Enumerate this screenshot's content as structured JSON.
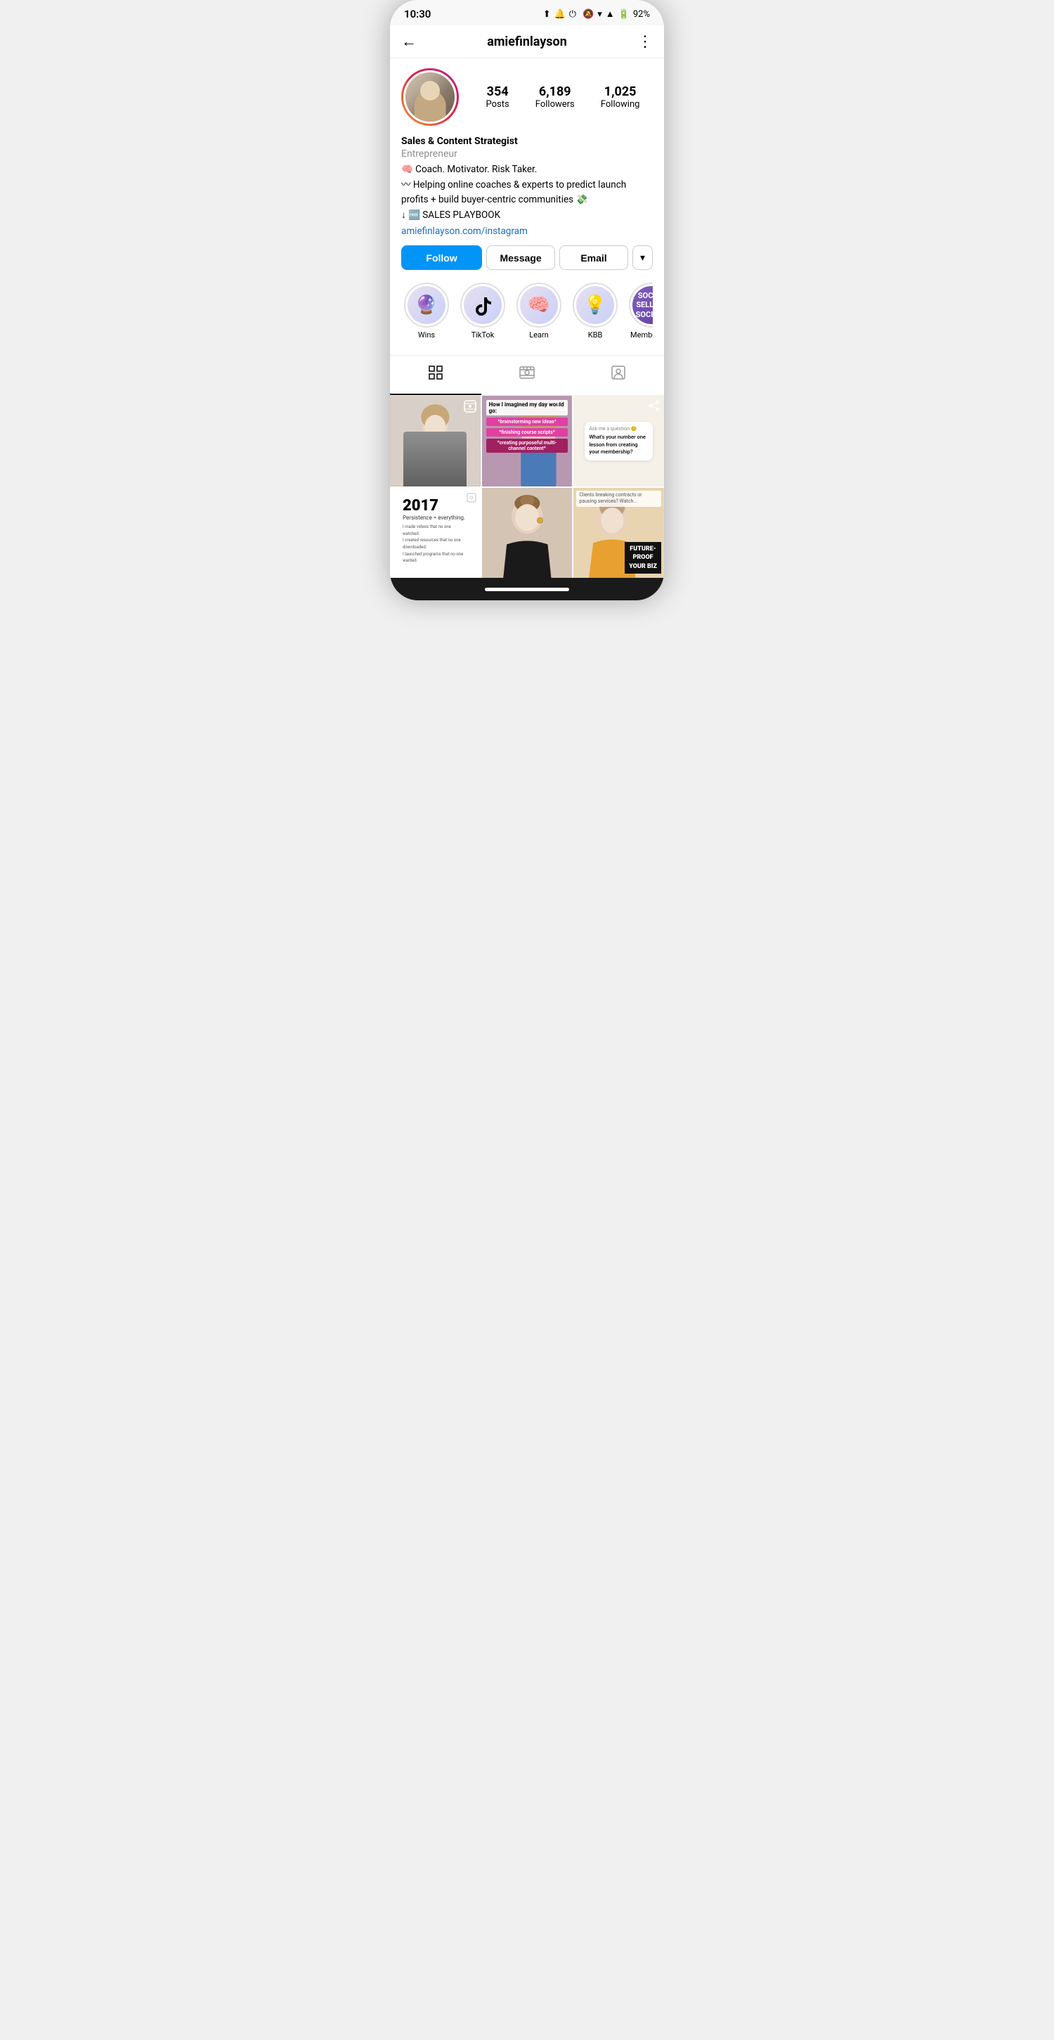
{
  "statusBar": {
    "time": "10:30",
    "battery": "92%"
  },
  "header": {
    "username": "amiefinlayson",
    "back_label": "←",
    "more_label": "⋮"
  },
  "profile": {
    "stats": {
      "posts_count": "354",
      "posts_label": "Posts",
      "followers_count": "6,189",
      "followers_label": "Followers",
      "following_count": "1,025",
      "following_label": "Following"
    },
    "bio": {
      "name": "Sales & Content Strategist",
      "category": "Entrepreneur",
      "line1": "🧠 Coach. Motivator. Risk Taker.",
      "line2": "〰 Helping online coaches & experts to predict launch profits + build buyer-centric communities 💸",
      "line3": "↓ 🆓 SALES PLAYBOOK",
      "link": "amiefinlayson.com/instagram"
    }
  },
  "buttons": {
    "follow": "Follow",
    "message": "Message",
    "email": "Email",
    "dropdown": "▾"
  },
  "highlights": [
    {
      "id": "wins",
      "icon": "🔮",
      "label": "Wins"
    },
    {
      "id": "tiktok",
      "icon": "♪",
      "label": "TikTok"
    },
    {
      "id": "learn",
      "icon": "🧠",
      "label": "Learn"
    },
    {
      "id": "kbb",
      "icon": "💡",
      "label": "KBB"
    },
    {
      "id": "membership",
      "text": "SOCIAL\nSELLING\nSOCIETY",
      "label": "Membersh…"
    }
  ],
  "tabs": [
    {
      "id": "grid",
      "icon": "⊞",
      "active": true
    },
    {
      "id": "reels",
      "icon": "▶",
      "active": false
    },
    {
      "id": "tagged",
      "icon": "👤",
      "active": false
    }
  ],
  "posts": [
    {
      "id": "post1",
      "type": "video",
      "description": "Woman in grey shirt gesturing"
    },
    {
      "id": "post2",
      "type": "text_overlay",
      "title": "How I imagined my day would go:",
      "tags": [
        "*brainstorming new ideas*",
        "*finishing course scripts*",
        "*creating purposeful multi-channel content*"
      ]
    },
    {
      "id": "post3",
      "type": "question",
      "question": "Ask me a question 😊✨",
      "text": "What's your number one lesson from creating your membership?"
    },
    {
      "id": "post4",
      "type": "text",
      "year": "2017",
      "subtitle": "Persistence = everything.",
      "lines": [
        "I made videos that no one watched.",
        "I created resources that no one downloaded.",
        "I launched programs that no one wanted."
      ]
    },
    {
      "id": "post5",
      "type": "photo",
      "description": "Woman with hair up smiling"
    },
    {
      "id": "post6",
      "type": "text_overlay",
      "text": "Clients breaking contracts or pausing services? Watch...",
      "label_line1": "FUTURE-",
      "label_line2": "PROOF",
      "label_line3": "YOUR BIZ"
    }
  ]
}
